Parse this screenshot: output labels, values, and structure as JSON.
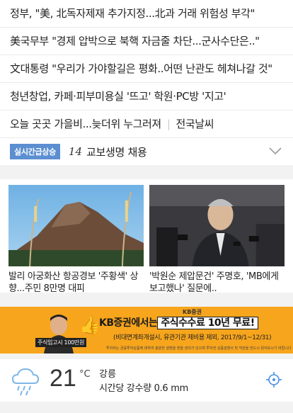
{
  "news": [
    {
      "title": "정부, \"美, 北독자제재 추가지정...北과 거래 위험성 부각\""
    },
    {
      "title": "美국무부 \"경제 압박으로 북핵 자금줄 차단...군사수단은..\""
    },
    {
      "title": "文대통령 \"우리가 가야할길은 평화..어떤 난관도 헤쳐나갈 것\""
    },
    {
      "title": "청년창업, 카페·피부미용실 '뜨고' 학원·PC방 '지고'"
    },
    {
      "title": "오늘 곳곳 가을비...늦더위 누그러져",
      "extra": "전국날씨"
    }
  ],
  "realtime": {
    "badge": "실시간급상승",
    "rank": "14",
    "keyword": "교보생명 채용"
  },
  "cards": [
    {
      "caption": "발리 아궁화산 항공경보 '주황색' 상향...주민 8만명 대피",
      "image": "volcano-photo"
    },
    {
      "caption": "'박원순 제압문건' 주명호, 'MB에게 보고했나' 질문에..",
      "image": "press-photo"
    }
  ],
  "ad": {
    "brand": "KB증권",
    "headline_pre": "KB증권에서는",
    "headline_hl": "주식수수료 10년 무료!",
    "sub": "(비대면계좌개설시, 유관기관 제비용 제외, 2017/9/1~12/31)",
    "tag": "주식입고시 100만원",
    "fine": "투자자는 금융투자상품에 대하여 충분한 설명을 받을 권리가 있으며 투자전 상품설명서 및 약관을 반드시 읽어보시기 바랍니다"
  },
  "weather": {
    "temp": "21",
    "unit": "°C",
    "location": "강릉",
    "info": "시간당 강수량 0.6 mm",
    "icon": "rain-cloud-icon"
  },
  "colors": {
    "badge": "#5b8fd1",
    "ad_bg": "#f7a51c",
    "weather_icon": "#7eb6e6",
    "locate_icon": "#4a90e2"
  }
}
